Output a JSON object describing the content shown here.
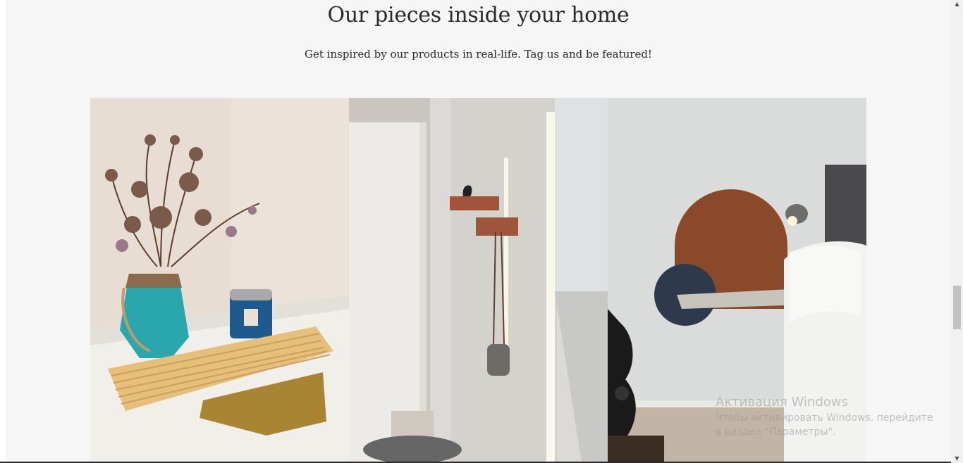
{
  "section": {
    "title": "Our pieces inside your home",
    "subtitle": "Get inspired by our products in real-life. Tag us and be featured!"
  },
  "gallery": [
    {
      "icon": "photo-dried-flowers-vase-gold-tray"
    },
    {
      "icon": "photo-wall-shelves-hallway"
    },
    {
      "icon": "photo-wall-nightstand-bedroom"
    }
  ],
  "watermark": {
    "title": "Активация Windows",
    "text": "Чтобы активировать Windows, перейдите в раздел \"Параметры\"."
  },
  "scrollbar": {
    "up_icon": "scroll-up-arrow-icon",
    "down_icon": "scroll-down-arrow-icon"
  }
}
